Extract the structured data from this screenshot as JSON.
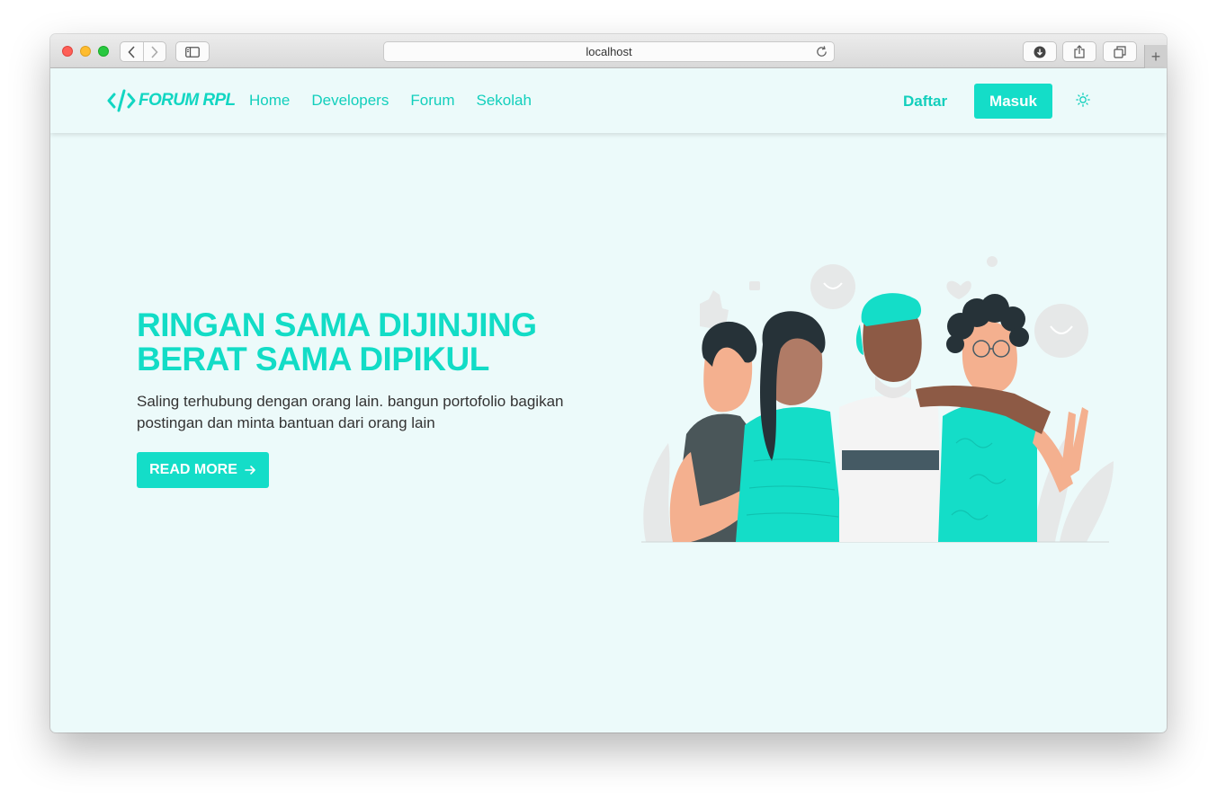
{
  "browser": {
    "url": "localhost"
  },
  "navbar": {
    "brand": "FORUM RPL",
    "links": [
      "Home",
      "Developers",
      "Forum",
      "Sekolah"
    ],
    "daftar_label": "Daftar",
    "masuk_label": "Masuk",
    "theme_icon": "sun-icon"
  },
  "hero": {
    "title_line1": "RINGAN SAMA DIJINJING",
    "title_line2": "BERAT SAMA DIPIKUL",
    "description": "Saling terhubung dengan orang lain. bangun portofolio bagikan postingan dan minta bantuan dari orang lain",
    "read_more_label": "READ MORE",
    "read_more_icon": "arrow-right-icon"
  },
  "colors": {
    "accent": "#14ddc8",
    "background": "#ecfafa",
    "text": "#333333"
  }
}
